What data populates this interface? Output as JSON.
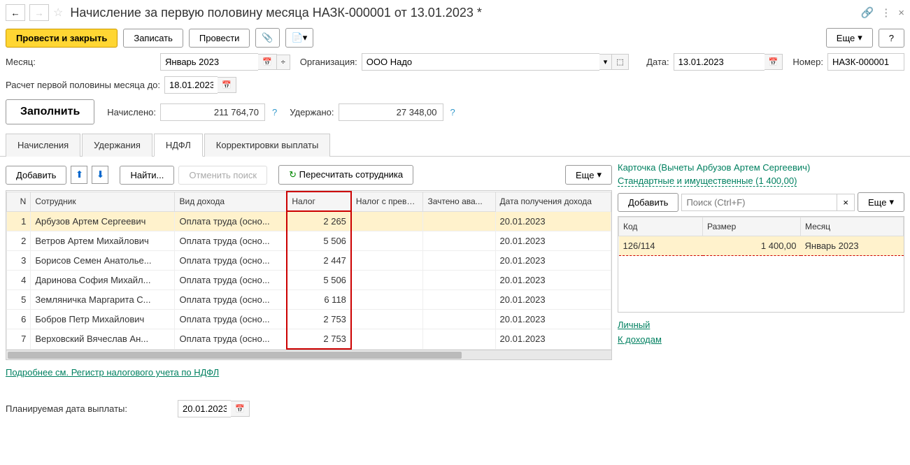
{
  "header": {
    "title": "Начисление за первую половину месяца НАЗК-000001 от 13.01.2023 *"
  },
  "toolbar": {
    "submit_close": "Провести и закрыть",
    "save": "Записать",
    "submit": "Провести",
    "more": "Еще",
    "help": "?"
  },
  "fields": {
    "month_label": "Месяц:",
    "month_value": "Январь 2023",
    "org_label": "Организация:",
    "org_value": "ООО Надо",
    "date_label": "Дата:",
    "date_value": "13.01.2023",
    "number_label": "Номер:",
    "number_value": "НАЗК-000001",
    "calc_until_label": "Расчет первой половины месяца до:",
    "calc_until_value": "18.01.2023",
    "fill_btn": "Заполнить",
    "accrued_label": "Начислено:",
    "accrued_value": "211 764,70",
    "withheld_label": "Удержано:",
    "withheld_value": "27 348,00",
    "planned_date_label": "Планируемая дата выплаты:",
    "planned_date_value": "20.01.2023"
  },
  "tabs": {
    "t1": "Начисления",
    "t2": "Удержания",
    "t3": "НДФЛ",
    "t4": "Корректировки выплаты"
  },
  "panel_toolbar": {
    "add": "Добавить",
    "find": "Найти...",
    "cancel_search": "Отменить поиск",
    "recalc": "Пересчитать сотрудника",
    "more": "Еще"
  },
  "table": {
    "headers": {
      "n": "N",
      "emp": "Сотрудник",
      "type": "Вид дохода",
      "tax": "Налог",
      "tax_excess": "Налог с превы...",
      "advance": "Зачтено ава...",
      "date": "Дата получения дохода"
    },
    "rows": [
      {
        "n": "1",
        "emp": "Арбузов Артем Сергеевич",
        "type": "Оплата труда (осно...",
        "tax": "2 265",
        "date": "20.01.2023"
      },
      {
        "n": "2",
        "emp": "Ветров Артем Михайлович",
        "type": "Оплата труда (осно...",
        "tax": "5 506",
        "date": "20.01.2023"
      },
      {
        "n": "3",
        "emp": "Борисов Семен Анатолье...",
        "type": "Оплата труда (осно...",
        "tax": "2 447",
        "date": "20.01.2023"
      },
      {
        "n": "4",
        "emp": "Даринова София Михайл...",
        "type": "Оплата труда (осно...",
        "tax": "5 506",
        "date": "20.01.2023"
      },
      {
        "n": "5",
        "emp": "Земляничка Маргарита С...",
        "type": "Оплата труда (осно...",
        "tax": "6 118",
        "date": "20.01.2023"
      },
      {
        "n": "6",
        "emp": "Бобров Петр Михайлович",
        "type": "Оплата труда (осно...",
        "tax": "2 753",
        "date": "20.01.2023"
      },
      {
        "n": "7",
        "emp": "Верховский Вячеслав Ан...",
        "type": "Оплата труда (осно...",
        "tax": "2 753",
        "date": "20.01.2023"
      }
    ]
  },
  "details_link": "Подробнее см. Регистр налогового учета по НДФЛ",
  "right": {
    "card_title": "Карточка (Вычеты Арбузов Артем Сергеевич)",
    "deductions_link": "Стандартные и имущественные (1 400,00)",
    "add": "Добавить",
    "search_placeholder": "Поиск (Ctrl+F)",
    "more": "Еще",
    "headers": {
      "code": "Код",
      "size": "Размер",
      "month": "Месяц"
    },
    "row": {
      "code": "126/114",
      "size": "1 400,00",
      "month": "Январь 2023"
    },
    "personal": "Личный",
    "to_income": "К доходам"
  }
}
